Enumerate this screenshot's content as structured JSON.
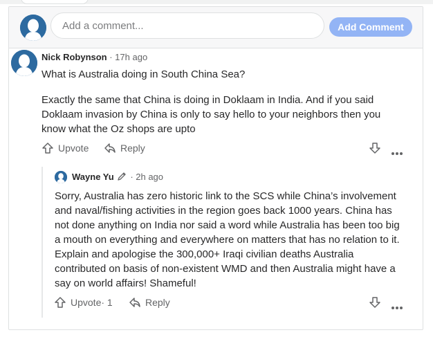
{
  "composer": {
    "placeholder": "Add a comment...",
    "button_label": "Add Comment"
  },
  "comments": [
    {
      "author": "Nick Robynson",
      "time": " · 17h ago",
      "question": "What is Australia doing in South China Sea?",
      "text": "Exactly the same that China is doing in Doklaam in India. And if you said Doklaam invasion by China is only to say hello to your neighbors then you know what the Oz shops are upto",
      "upvote_label": "Upvote",
      "reply_label": "Reply"
    },
    {
      "author": "Wayne Yu",
      "time": " · 2h ago",
      "text": "Sorry, Australia has zero historic link to the SCS while China’s involvement and naval/fishing activities in the region goes back 1000 years. China has not done anything on India nor said a word while Australia has been too big a mouth on everything and everywhere on matters that has no relation to it. Explain and apologise the 300,000+ Iraqi civilian deaths Australia contributed on basis of non-existent WMD and then Australia might have a say on world affairs! Shameful!",
      "upvote_label": "Upvote",
      "upvote_count": " · 1",
      "reply_label": "Reply"
    }
  ],
  "icons": {
    "avatar": "default-user-avatar-icon",
    "upvote": "upvote-arrow-icon",
    "reply": "reply-arrow-icon",
    "downvote": "downvote-arrow-icon",
    "more": "more-dots-icon",
    "edit": "pencil-icon"
  },
  "colors": {
    "accent_button": "#93b4f5",
    "avatar_blue": "#2d6aa0",
    "text": "#282829",
    "muted": "#636466"
  }
}
